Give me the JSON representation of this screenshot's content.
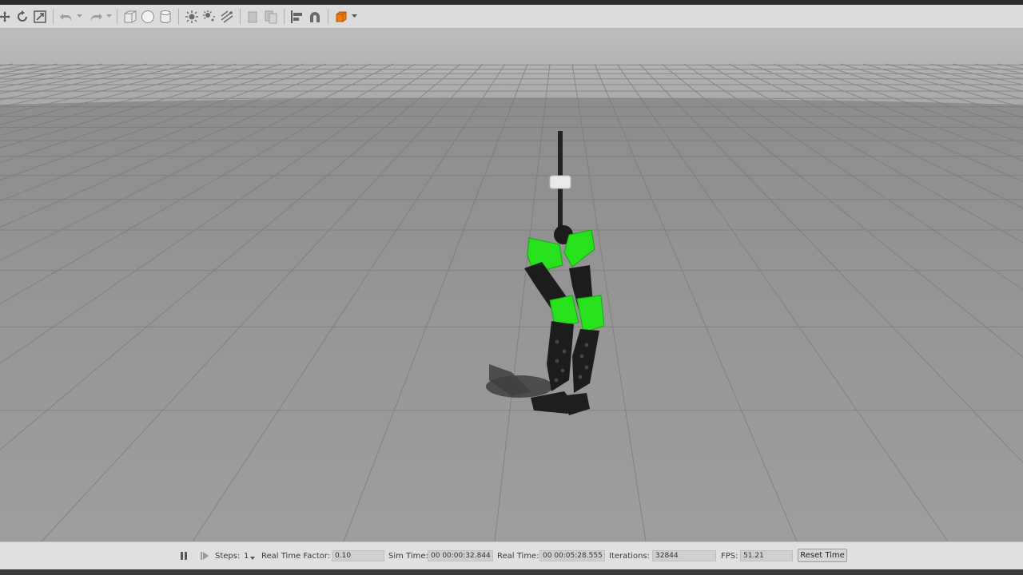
{
  "toolbar": {
    "icons": [
      "translate-icon",
      "rotate-icon",
      "scale-icon",
      "undo-icon",
      "undo-history-icon",
      "redo-icon",
      "redo-history-icon",
      "box-icon",
      "sphere-icon",
      "cylinder-icon",
      "point-light-icon",
      "spot-light-icon",
      "directional-light-icon",
      "copy-icon",
      "paste-icon",
      "align-icon",
      "snap-icon",
      "view-angle-icon"
    ]
  },
  "scene": {
    "ground_color": "#8a8a8a",
    "sky_color": "#b3b3b3",
    "robot_green": "#27e11c",
    "robot_black": "#1c1c1c"
  },
  "status_bar": {
    "steps_label": "Steps:",
    "steps_value": "1",
    "rtf_label": "Real Time Factor:",
    "rtf_value": "0.10",
    "sim_time_label": "Sim Time:",
    "sim_time_value": "00 00:00:32.844",
    "real_time_label": "Real Time:",
    "real_time_value": "00 00:05:28.555",
    "iterations_label": "Iterations:",
    "iterations_value": "32844",
    "fps_label": "FPS:",
    "fps_value": "51.21",
    "reset_label": "Reset Time"
  }
}
